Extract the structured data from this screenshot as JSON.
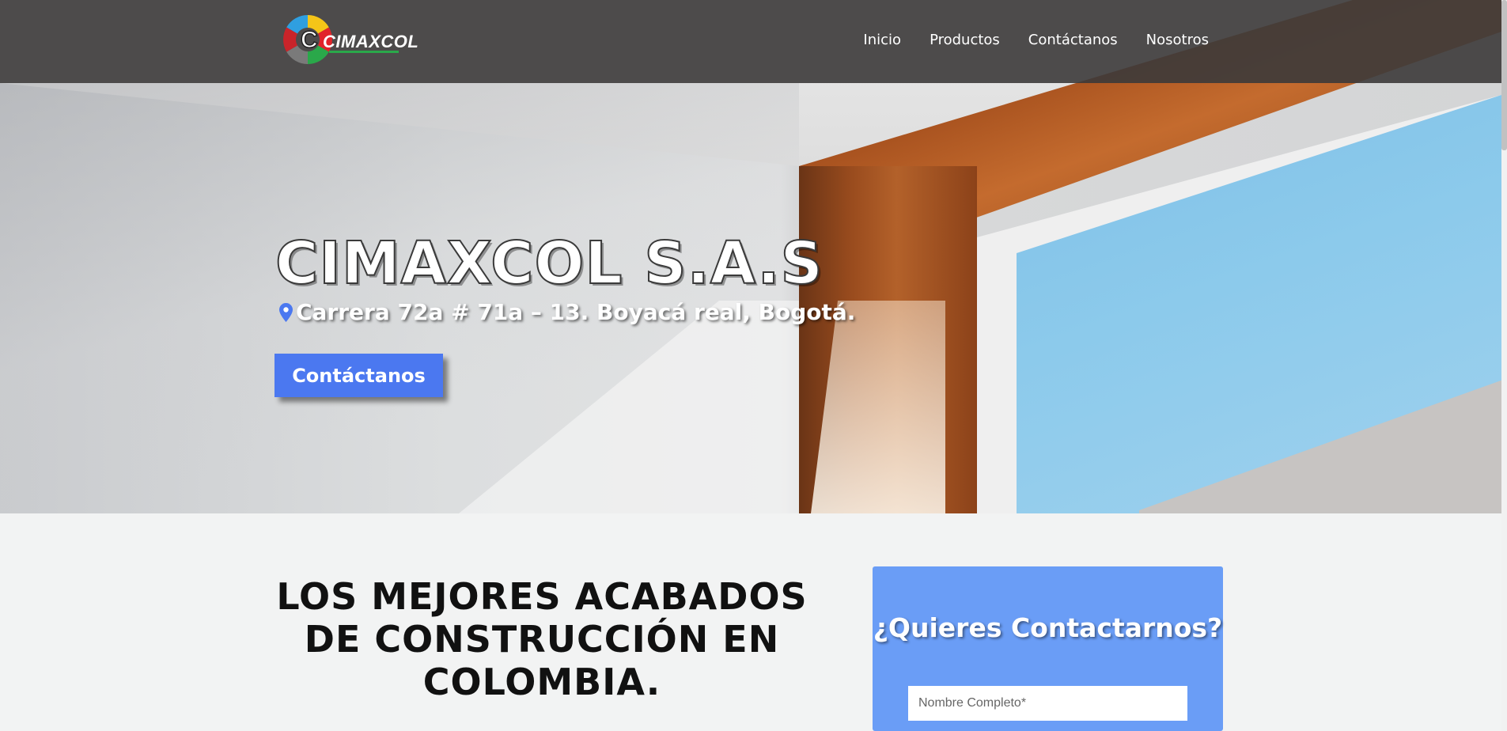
{
  "nav": {
    "logo_text": "CIMAXCOL",
    "links": [
      "Inicio",
      "Productos",
      "Contáctanos",
      "Nosotros"
    ]
  },
  "hero": {
    "title": "CIMAXCOL S.A.S",
    "address": "Carrera 72a # 71a – 13. Boyacá real, Bogotá.",
    "address_icon": "location-pin-icon",
    "cta_label": "Contáctanos"
  },
  "main": {
    "headline": "LOS MEJORES ACABADOS DE CONSTRUCCIÓN EN COLOMBIA."
  },
  "contact": {
    "title": "¿Quieres Contactarnos?",
    "name_placeholder": "Nombre Completo*"
  },
  "colors": {
    "nav_bg": "#3c3a3a",
    "accent_button": "#4b78f0",
    "contact_card": "#6a9df6",
    "page_bg": "#f2f3f3"
  }
}
